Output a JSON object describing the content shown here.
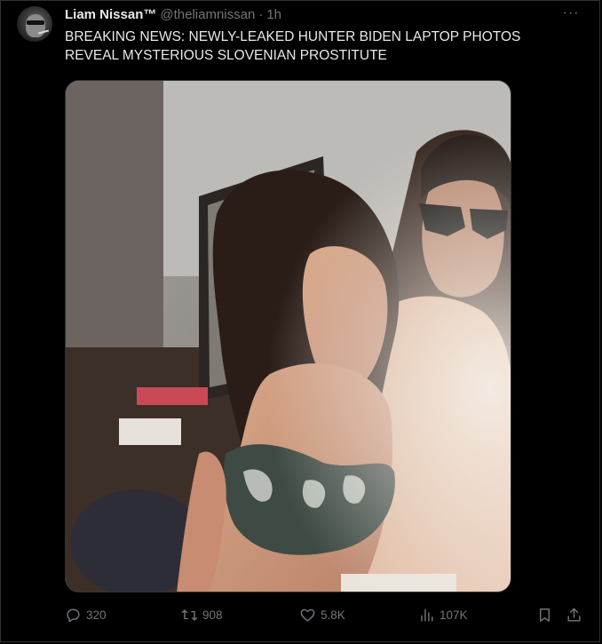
{
  "tweet": {
    "author_name": "Liam Nissan™",
    "author_handle": "@theliamnissan",
    "separator": "·",
    "time": "1h",
    "text": "BREAKING NEWS: NEWLY-LEAKED HUNTER BIDEN LAPTOP PHOTOS REVEAL MYSTERIOUS SLOVENIAN PROSTITUTE",
    "more_icon": "more-horizontal-icon"
  },
  "actions": {
    "replies": "320",
    "retweets": "908",
    "likes": "5.8K",
    "views": "107K",
    "icons": {
      "reply": "reply-icon",
      "retweet": "retweet-icon",
      "like": "heart-icon",
      "views": "views-bar-chart-icon",
      "bookmark": "bookmark-icon",
      "share": "share-icon"
    }
  },
  "colors": {
    "background": "#000000",
    "text": "#e7e9ea",
    "secondary": "#71767b",
    "border": "#2f3336"
  }
}
